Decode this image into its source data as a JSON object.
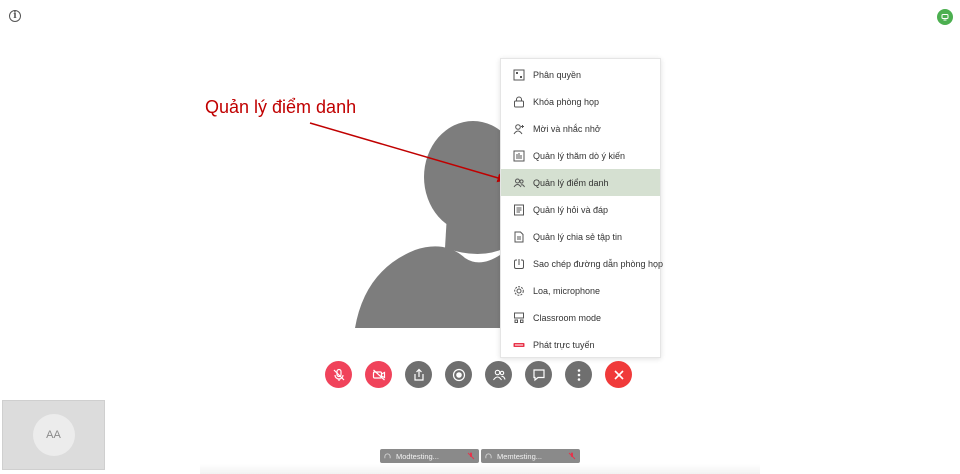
{
  "header": {
    "info_icon": "info-icon",
    "status_icon": "network-status-icon",
    "accent_color": "#4caf50"
  },
  "annotation": {
    "label": "Quản lý điểm danh",
    "color": "#c00000"
  },
  "menu": {
    "items": [
      {
        "label": "Phân quyền",
        "icon": "permissions-icon"
      },
      {
        "label": "Khóa phòng họp",
        "icon": "lock-icon"
      },
      {
        "label": "Mời và nhắc nhở",
        "icon": "invite-user-icon"
      },
      {
        "label": "Quản lý thăm dò ý kiến",
        "icon": "poll-icon"
      },
      {
        "label": "Quản lý điểm danh",
        "icon": "attendance-icon",
        "active": true
      },
      {
        "label": "Quản lý hỏi và đáp",
        "icon": "qa-icon"
      },
      {
        "label": "Quản lý chia sẻ tập tin",
        "icon": "file-share-icon"
      },
      {
        "label": "Sao chép đường dẫn phòng họp",
        "icon": "copy-link-icon"
      },
      {
        "label": "Loa, microphone",
        "icon": "settings-gear-icon"
      },
      {
        "label": "Classroom mode",
        "icon": "classroom-icon"
      },
      {
        "label": "Phát trực tuyến",
        "icon": "live-stream-icon"
      }
    ],
    "active_color": "#d5e0d1"
  },
  "toolbar": {
    "buttons": [
      "mic-muted-icon",
      "camera-off-icon",
      "share-screen-icon",
      "record-icon",
      "participants-icon",
      "chat-icon",
      "more-options-icon",
      "end-call-icon"
    ],
    "red_color": "#f0435b",
    "gray_color": "#6f6f6f"
  },
  "self_view": {
    "initials": "AA"
  },
  "participants": [
    {
      "name": "Modtesting..."
    },
    {
      "name": "Memtesting..."
    }
  ]
}
